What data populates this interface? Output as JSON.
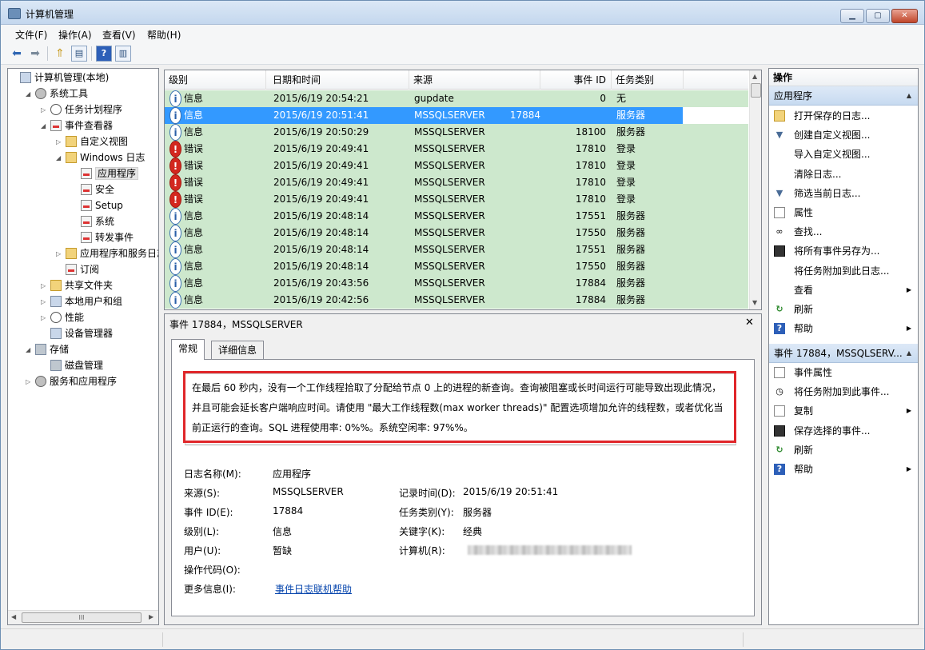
{
  "window": {
    "title": "计算机管理"
  },
  "menu": [
    "文件(F)",
    "操作(A)",
    "查看(V)",
    "帮助(H)"
  ],
  "tree": [
    {
      "label": "计算机管理(本地)",
      "icon": "computer-management-icon",
      "indent": 0,
      "expander": "",
      "kind": "comp"
    },
    {
      "label": "系统工具",
      "icon": "system-tools-icon",
      "indent": 1,
      "expander": "◢",
      "kind": "gear"
    },
    {
      "label": "任务计划程序",
      "icon": "task-scheduler-icon",
      "indent": 2,
      "expander": "▷",
      "kind": "clock"
    },
    {
      "label": "事件查看器",
      "icon": "event-viewer-icon",
      "indent": 2,
      "expander": "◢",
      "kind": "log"
    },
    {
      "label": "自定义视图",
      "icon": "folder-icon",
      "indent": 3,
      "expander": "▷",
      "kind": "folder"
    },
    {
      "label": "Windows 日志",
      "icon": "folder-icon",
      "indent": 3,
      "expander": "◢",
      "kind": "folder"
    },
    {
      "label": "应用程序",
      "icon": "log-icon",
      "indent": 4,
      "expander": "",
      "kind": "log",
      "selected": true
    },
    {
      "label": "安全",
      "icon": "log-icon",
      "indent": 4,
      "expander": "",
      "kind": "log"
    },
    {
      "label": "Setup",
      "icon": "log-icon",
      "indent": 4,
      "expander": "",
      "kind": "log"
    },
    {
      "label": "系统",
      "icon": "log-icon",
      "indent": 4,
      "expander": "",
      "kind": "log"
    },
    {
      "label": "转发事件",
      "icon": "log-icon",
      "indent": 4,
      "expander": "",
      "kind": "log"
    },
    {
      "label": "应用程序和服务日志",
      "icon": "folder-icon",
      "indent": 3,
      "expander": "▷",
      "kind": "folder"
    },
    {
      "label": "订阅",
      "icon": "subscription-icon",
      "indent": 3,
      "expander": "",
      "kind": "log"
    },
    {
      "label": "共享文件夹",
      "icon": "shared-folder-icon",
      "indent": 2,
      "expander": "▷",
      "kind": "folder"
    },
    {
      "label": "本地用户和组",
      "icon": "users-icon",
      "indent": 2,
      "expander": "▷",
      "kind": "comp"
    },
    {
      "label": "性能",
      "icon": "performance-icon",
      "indent": 2,
      "expander": "▷",
      "kind": "clock"
    },
    {
      "label": "设备管理器",
      "icon": "device-manager-icon",
      "indent": 2,
      "expander": "",
      "kind": "comp"
    },
    {
      "label": "存储",
      "icon": "storage-icon",
      "indent": 1,
      "expander": "◢",
      "kind": "disk"
    },
    {
      "label": "磁盘管理",
      "icon": "disk-management-icon",
      "indent": 2,
      "expander": "",
      "kind": "disk"
    },
    {
      "label": "服务和应用程序",
      "icon": "services-icon",
      "indent": 1,
      "expander": "▷",
      "kind": "gear"
    }
  ],
  "tree_scroll_label": "III",
  "events": {
    "columns": [
      "级别",
      "日期和时间",
      "来源",
      "事件 ID",
      "任务类别"
    ],
    "rows": [
      {
        "level": "信息",
        "type": "info",
        "datetime": "2015/6/19 20:54:21",
        "source": "gupdate",
        "id": "0",
        "category": "无"
      },
      {
        "level": "信息",
        "type": "info",
        "datetime": "2015/6/19 20:51:41",
        "source": "MSSQLSERVER",
        "id": "17884",
        "category": "服务器",
        "selected": true
      },
      {
        "level": "信息",
        "type": "info",
        "datetime": "2015/6/19 20:50:29",
        "source": "MSSQLSERVER",
        "id": "18100",
        "category": "服务器"
      },
      {
        "level": "错误",
        "type": "err",
        "datetime": "2015/6/19 20:49:41",
        "source": "MSSQLSERVER",
        "id": "17810",
        "category": "登录"
      },
      {
        "level": "错误",
        "type": "err",
        "datetime": "2015/6/19 20:49:41",
        "source": "MSSQLSERVER",
        "id": "17810",
        "category": "登录"
      },
      {
        "level": "错误",
        "type": "err",
        "datetime": "2015/6/19 20:49:41",
        "source": "MSSQLSERVER",
        "id": "17810",
        "category": "登录"
      },
      {
        "level": "错误",
        "type": "err",
        "datetime": "2015/6/19 20:49:41",
        "source": "MSSQLSERVER",
        "id": "17810",
        "category": "登录"
      },
      {
        "level": "信息",
        "type": "info",
        "datetime": "2015/6/19 20:48:14",
        "source": "MSSQLSERVER",
        "id": "17551",
        "category": "服务器"
      },
      {
        "level": "信息",
        "type": "info",
        "datetime": "2015/6/19 20:48:14",
        "source": "MSSQLSERVER",
        "id": "17550",
        "category": "服务器"
      },
      {
        "level": "信息",
        "type": "info",
        "datetime": "2015/6/19 20:48:14",
        "source": "MSSQLSERVER",
        "id": "17551",
        "category": "服务器"
      },
      {
        "level": "信息",
        "type": "info",
        "datetime": "2015/6/19 20:48:14",
        "source": "MSSQLSERVER",
        "id": "17550",
        "category": "服务器"
      },
      {
        "level": "信息",
        "type": "info",
        "datetime": "2015/6/19 20:43:56",
        "source": "MSSQLSERVER",
        "id": "17884",
        "category": "服务器"
      },
      {
        "level": "信息",
        "type": "info",
        "datetime": "2015/6/19 20:42:56",
        "source": "MSSQLSERVER",
        "id": "17884",
        "category": "服务器"
      }
    ]
  },
  "detail": {
    "title": "事件 17884，MSSQLSERVER",
    "tabs": [
      "常规",
      "详细信息"
    ],
    "description": "在最后 60 秒内，没有一个工作线程拾取了分配给节点 0 上的进程的新查询。查询被阻塞或长时间运行可能导致出现此情况，并且可能会延长客户端响应时间。请使用 \"最大工作线程数(max worker threads)\" 配置选项增加允许的线程数，或者优化当前正运行的查询。SQL 进程使用率: 0%%。系统空闲率: 97%%。",
    "fields": {
      "log_name_label": "日志名称(M):",
      "log_name": "应用程序",
      "source_label": "来源(S):",
      "source": "MSSQLSERVER",
      "logged_label": "记录时间(D):",
      "logged": "2015/6/19 20:51:41",
      "event_id_label": "事件 ID(E):",
      "event_id": "17884",
      "task_label": "任务类别(Y):",
      "task": "服务器",
      "level_label": "级别(L):",
      "level": "信息",
      "keywords_label": "关键字(K):",
      "keywords": "经典",
      "user_label": "用户(U):",
      "user": "暂缺",
      "computer_label": "计算机(R):",
      "opcode_label": "操作代码(O):",
      "more_info_label": "更多信息(I):",
      "more_info_link": "事件日志联机帮助"
    }
  },
  "actions": {
    "title": "操作",
    "section1": "应用程序",
    "section1_items": [
      {
        "label": "打开保存的日志...",
        "icon": "open-folder-icon",
        "cls": "folder",
        "glyph": "",
        "sub": false
      },
      {
        "label": "创建自定义视图...",
        "icon": "create-view-icon",
        "cls": "funnel",
        "glyph": "▼",
        "sub": false
      },
      {
        "label": "导入自定义视图...",
        "icon": "",
        "cls": "",
        "glyph": "",
        "sub": false
      },
      {
        "label": "清除日志...",
        "icon": "",
        "cls": "",
        "glyph": "",
        "sub": false
      },
      {
        "label": "筛选当前日志...",
        "icon": "filter-icon",
        "cls": "funnel",
        "glyph": "▼",
        "sub": false
      },
      {
        "label": "属性",
        "icon": "properties-icon",
        "cls": "doc",
        "glyph": "",
        "sub": false
      },
      {
        "label": "查找...",
        "icon": "find-icon",
        "cls": "",
        "glyph": "∞",
        "sub": false
      },
      {
        "label": "将所有事件另存为...",
        "icon": "save-icon",
        "cls": "disk",
        "glyph": "",
        "sub": false
      },
      {
        "label": "将任务附加到此日志...",
        "icon": "",
        "cls": "",
        "glyph": "",
        "sub": false
      },
      {
        "label": "查看",
        "icon": "",
        "cls": "",
        "glyph": "",
        "sub": true
      },
      {
        "label": "刷新",
        "icon": "refresh-icon",
        "cls": "green",
        "glyph": "↻",
        "sub": false
      },
      {
        "label": "帮助",
        "icon": "help-icon",
        "cls": "blue",
        "glyph": "?",
        "sub": true
      }
    ],
    "section2": "事件 17884，MSSQLSERV...",
    "section2_items": [
      {
        "label": "事件属性",
        "icon": "event-properties-icon",
        "cls": "doc",
        "glyph": "",
        "sub": false
      },
      {
        "label": "将任务附加到此事件...",
        "icon": "attach-task-icon",
        "cls": "",
        "glyph": "◷",
        "sub": false
      },
      {
        "label": "复制",
        "icon": "copy-icon",
        "cls": "doc",
        "glyph": "",
        "sub": true
      },
      {
        "label": "保存选择的事件...",
        "icon": "save-icon",
        "cls": "disk",
        "glyph": "",
        "sub": false
      },
      {
        "label": "刷新",
        "icon": "refresh-icon",
        "cls": "green",
        "glyph": "↻",
        "sub": false
      },
      {
        "label": "帮助",
        "icon": "help-icon",
        "cls": "blue",
        "glyph": "?",
        "sub": true
      }
    ]
  }
}
